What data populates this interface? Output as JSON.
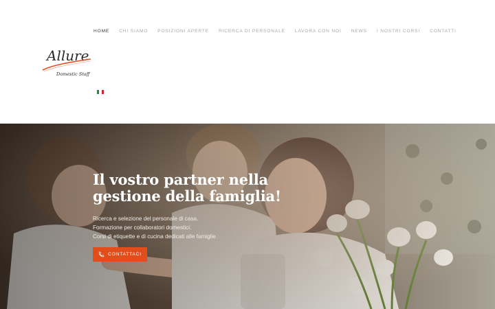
{
  "nav": {
    "items": [
      {
        "label": "HOME"
      },
      {
        "label": "CHI SIAMO"
      },
      {
        "label": "POSIZIONI APERTE"
      },
      {
        "label": "RICERCA DI PERSONALE"
      },
      {
        "label": "LAVORA CON NOI"
      },
      {
        "label": "NEWS"
      },
      {
        "label": "I NOSTRI CORSI"
      },
      {
        "label": "CONTATTI"
      }
    ],
    "active_index": 0
  },
  "logo": {
    "name": "Allure",
    "tagline": "Domestic Staff"
  },
  "languages": [
    {
      "icon": "italy-flag-icon"
    },
    {
      "icon": "uk-flag-icon"
    }
  ],
  "hero": {
    "title_line1": "Il vostro partner nella",
    "title_line2": "gestione della famiglia!",
    "lines": [
      "Ricerca e selezione del personale di casa.",
      "Formazione per collaboratori domestici.",
      "Corsi di etiquette e di cucina dedicati alle famiglie."
    ],
    "cta_label": "CONTATTACI",
    "cta_icon": "phone-icon"
  },
  "colors": {
    "accent": "#e24e1b",
    "nav_active": "#3d3d3d",
    "nav_inactive": "#a8a8a8"
  }
}
